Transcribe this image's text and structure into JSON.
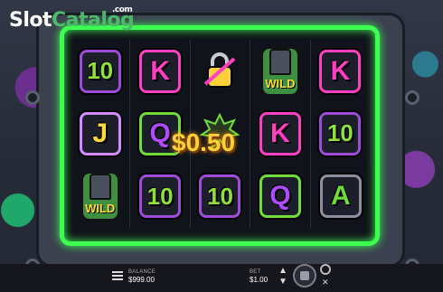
{
  "logo": {
    "brand": "Slot",
    "brand_accent": "Catalog",
    "tld": ".com"
  },
  "reels": [
    [
      "10",
      "J",
      "WILD"
    ],
    [
      "K",
      "Q",
      "10"
    ],
    [
      "lock",
      "scatter",
      "10"
    ],
    [
      "WILD",
      "K",
      "Q"
    ],
    [
      "K",
      "10",
      "A"
    ]
  ],
  "win_amount": "$0.50",
  "bottom_bar": {
    "balance_label": "BALANCE",
    "balance_value": "$999.00",
    "bet_label": "BET",
    "bet_value": "$1.00"
  }
}
